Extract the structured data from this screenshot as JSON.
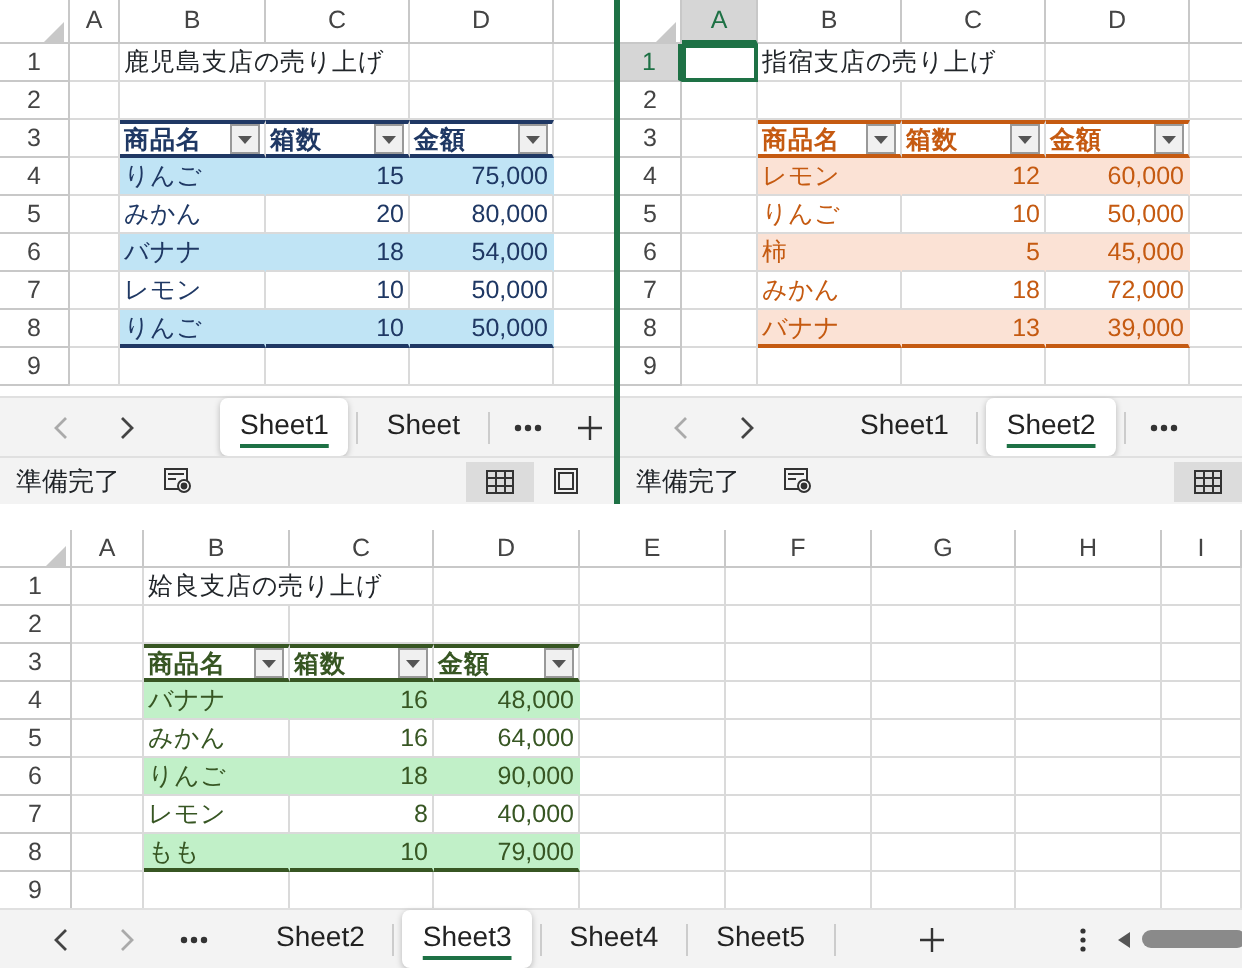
{
  "windows": [
    {
      "columns": [
        {
          "label": "A",
          "selected": false
        },
        {
          "label": "B",
          "selected": false
        },
        {
          "label": "C",
          "selected": false
        },
        {
          "label": "D",
          "selected": false
        }
      ],
      "rows": [
        {
          "label": "1",
          "selected": false
        },
        {
          "label": "2",
          "selected": false
        },
        {
          "label": "3",
          "selected": false
        },
        {
          "label": "4",
          "selected": false
        },
        {
          "label": "5",
          "selected": false
        },
        {
          "label": "6",
          "selected": false
        },
        {
          "label": "7",
          "selected": false
        },
        {
          "label": "8",
          "selected": false
        },
        {
          "label": "9",
          "selected": false
        }
      ],
      "title_cell": "鹿児島支店の売り上げ",
      "table": {
        "kind": "blue",
        "headers": [
          "商品名",
          "箱数",
          "金額"
        ],
        "rows": [
          [
            "りんご",
            "15",
            "75,000"
          ],
          [
            "みかん",
            "20",
            "80,000"
          ],
          [
            "バナナ",
            "18",
            "54,000"
          ],
          [
            "レモン",
            "10",
            "50,000"
          ],
          [
            "りんご",
            "10",
            "50,000"
          ]
        ]
      },
      "tab_bar": [
        {
          "kind": "prev",
          "disabled": true
        },
        {
          "kind": "next",
          "disabled": false
        },
        {
          "kind": "tab",
          "label": "Sheet1",
          "selected": true
        },
        {
          "kind": "tab",
          "label": "Sheet",
          "selected": false
        },
        {
          "kind": "more"
        },
        {
          "kind": "add"
        }
      ],
      "status": {
        "text": "準備完了",
        "views": [
          {
            "kind": "normal",
            "selected": true
          },
          {
            "kind": "page_layout",
            "selected": false
          }
        ]
      }
    },
    {
      "columns": [
        {
          "label": "A",
          "selected": true
        },
        {
          "label": "B",
          "selected": false
        },
        {
          "label": "C",
          "selected": false
        },
        {
          "label": "D",
          "selected": false
        }
      ],
      "rows": [
        {
          "label": "1",
          "selected": true
        },
        {
          "label": "2",
          "selected": false
        },
        {
          "label": "3",
          "selected": false
        },
        {
          "label": "4",
          "selected": false
        },
        {
          "label": "5",
          "selected": false
        },
        {
          "label": "6",
          "selected": false
        },
        {
          "label": "7",
          "selected": false
        },
        {
          "label": "8",
          "selected": false
        },
        {
          "label": "9",
          "selected": false
        }
      ],
      "title_cell": "指宿支店の売り上げ",
      "table": {
        "kind": "orange",
        "headers": [
          "商品名",
          "箱数",
          "金額"
        ],
        "rows": [
          [
            "レモン",
            "12",
            "60,000"
          ],
          [
            "りんご",
            "10",
            "50,000"
          ],
          [
            "柿",
            "5",
            "45,000"
          ],
          [
            "みかん",
            "18",
            "72,000"
          ],
          [
            "バナナ",
            "13",
            "39,000"
          ]
        ]
      },
      "tab_bar": [
        {
          "kind": "prev",
          "disabled": true
        },
        {
          "kind": "next",
          "disabled": false
        },
        {
          "kind": "tab",
          "label": "Sheet1",
          "selected": false
        },
        {
          "kind": "tab",
          "label": "Sheet2",
          "selected": true
        },
        {
          "kind": "more"
        }
      ],
      "status": {
        "text": "準備完了",
        "views": [
          {
            "kind": "normal",
            "selected": true
          }
        ]
      }
    },
    {
      "columns": [
        {
          "label": "A",
          "selected": false
        },
        {
          "label": "B",
          "selected": false
        },
        {
          "label": "C",
          "selected": false
        },
        {
          "label": "D",
          "selected": false
        },
        {
          "label": "E",
          "selected": false
        },
        {
          "label": "F",
          "selected": false
        },
        {
          "label": "G",
          "selected": false
        },
        {
          "label": "H",
          "selected": false
        },
        {
          "label": "I",
          "selected": false
        }
      ],
      "rows": [
        {
          "label": "1",
          "selected": false
        },
        {
          "label": "2",
          "selected": false
        },
        {
          "label": "3",
          "selected": false
        },
        {
          "label": "4",
          "selected": false
        },
        {
          "label": "5",
          "selected": false
        },
        {
          "label": "6",
          "selected": false
        },
        {
          "label": "7",
          "selected": false
        },
        {
          "label": "8",
          "selected": false
        },
        {
          "label": "9",
          "selected": false
        }
      ],
      "title_cell": "姶良支店の売り上げ",
      "table": {
        "kind": "green",
        "headers": [
          "商品名",
          "箱数",
          "金額"
        ],
        "rows": [
          [
            "バナナ",
            "16",
            "48,000"
          ],
          [
            "みかん",
            "16",
            "64,000"
          ],
          [
            "りんご",
            "18",
            "90,000"
          ],
          [
            "レモン",
            "8",
            "40,000"
          ],
          [
            "もも",
            "10",
            "79,000"
          ]
        ]
      },
      "tab_bar": [
        {
          "kind": "prev",
          "disabled": false
        },
        {
          "kind": "next",
          "disabled": true
        },
        {
          "kind": "more"
        },
        {
          "kind": "tab",
          "label": "Sheet2",
          "selected": false
        },
        {
          "kind": "tab",
          "label": "Sheet3",
          "selected": true
        },
        {
          "kind": "tab",
          "label": "Sheet4",
          "selected": false
        },
        {
          "kind": "tab",
          "label": "Sheet5",
          "selected": false
        },
        {
          "kind": "add"
        },
        {
          "kind": "options"
        },
        {
          "kind": "scrollbar"
        }
      ]
    }
  ]
}
